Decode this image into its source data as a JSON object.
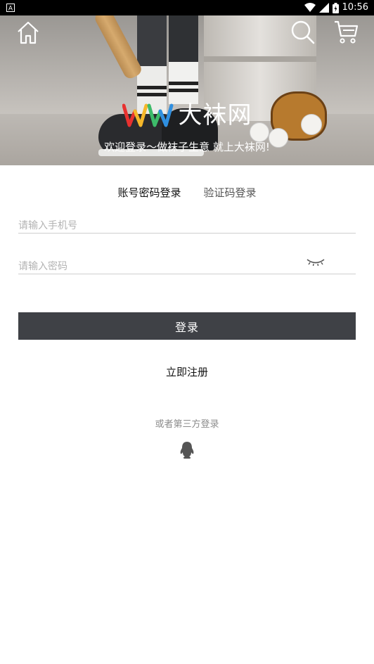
{
  "status_bar": {
    "time": "10:56"
  },
  "hero": {
    "brand_name": "大袜网",
    "slogan": "欢迎登录～做袜子生意 就上大袜网!"
  },
  "tabs": [
    {
      "label": "账号密码登录",
      "active": true
    },
    {
      "label": "验证码登录",
      "active": false
    }
  ],
  "form": {
    "phone_placeholder": "请输入手机号",
    "password_placeholder": "请输入密码",
    "login_label": "登录",
    "register_label": "立即注册",
    "third_party_label": "或者第三方登录"
  },
  "icons": {
    "home": "home-icon",
    "search": "search-icon",
    "cart": "cart-icon",
    "eye": "eye-closed-icon",
    "qq": "qq-icon"
  },
  "colors": {
    "button": "#3f4146",
    "logo_red": "#e8312f",
    "logo_yellow": "#f5b72a",
    "logo_green": "#3dbb6a",
    "logo_blue": "#2f8fe0"
  }
}
